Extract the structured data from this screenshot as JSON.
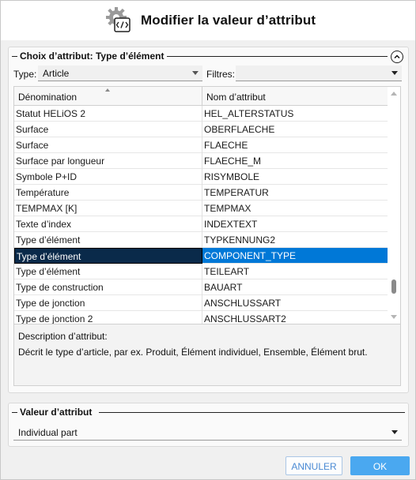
{
  "dialog": {
    "title": "Modifier la valeur d’attribut",
    "icon": "gear-code-icon"
  },
  "group_choice": {
    "header": "Choix d’attribut: Type d’élément",
    "collapse_icon": "chevron-up-circle-icon"
  },
  "filters": {
    "type_label": "Type:",
    "type_value": "Article",
    "filters_label": "Filtres:",
    "filters_value": ""
  },
  "table": {
    "columns": [
      "Dénomination",
      "Nom d’attribut"
    ],
    "rows": [
      [
        "Statut HELiOS 2",
        "HEL_ALTERSTATUS"
      ],
      [
        "Surface",
        "OBERFLAECHE"
      ],
      [
        "Surface",
        "FLAECHE"
      ],
      [
        "Surface par longueur",
        "FLAECHE_M"
      ],
      [
        "Symbole P+ID",
        "RISYMBOLE"
      ],
      [
        "Température",
        "TEMPERATUR"
      ],
      [
        "TEMPMAX [K]",
        "TEMPMAX"
      ],
      [
        "Texte d’index",
        "INDEXTEXT"
      ],
      [
        "Type d’élément",
        "TYPKENNUNG2"
      ],
      [
        "Type d’élément",
        "COMPONENT_TYPE"
      ],
      [
        "Type d’élément",
        "TEILEART"
      ],
      [
        "Type de construction",
        "BAUART"
      ],
      [
        "Type de jonction",
        "ANSCHLUSSART"
      ],
      [
        "Type de jonction 2",
        "ANSCHLUSSART2"
      ]
    ],
    "selected_row_index": 9,
    "scroll_position": 0.92
  },
  "description": {
    "title": "Description d’attribut:",
    "text": "Décrit le type d’article, par ex. Produit, Élément individuel, Ensemble, Élément brut."
  },
  "group_value": {
    "header": "Valeur d’attribut",
    "value": "Individual part"
  },
  "buttons": {
    "cancel": "ANNULER",
    "ok": "OK"
  },
  "colors": {
    "selection": "#0078d7",
    "ok_button": "#4aa8f0",
    "cancel_text": "#4a8ad4"
  }
}
